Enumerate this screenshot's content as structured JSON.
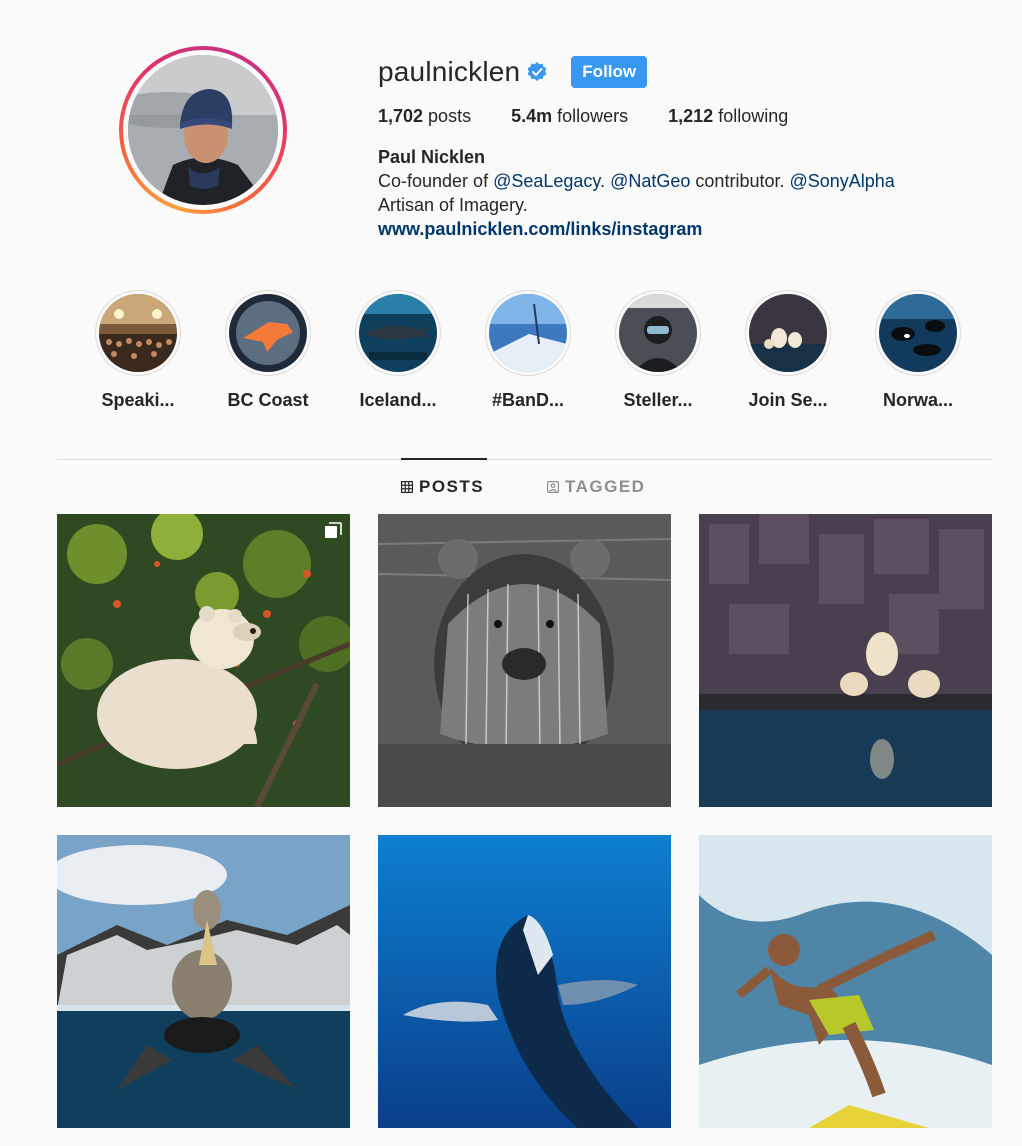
{
  "profile": {
    "username": "paulnicklen",
    "verified": true,
    "follow_label": "Follow",
    "stats": {
      "posts_count": "1,702",
      "posts_label": " posts",
      "followers_count": "5.4m",
      "followers_label": " followers",
      "following_count": "1,212",
      "following_label": " following"
    },
    "full_name": "Paul Nicklen",
    "bio": {
      "prefix": "Co-founder of ",
      "mention1": "@SeaLegacy",
      "sep1": ". ",
      "mention2": "@NatGeo",
      "mid": " contributor. ",
      "mention3": "@SonyAlpha",
      "line2": "Artisan of Imagery."
    },
    "link": "www.paulnicklen.com/links/instagram"
  },
  "highlights": [
    {
      "label": "Speaki..."
    },
    {
      "label": "BC Coast"
    },
    {
      "label": "Iceland..."
    },
    {
      "label": "#BanD..."
    },
    {
      "label": "Steller..."
    },
    {
      "label": "Join Se..."
    },
    {
      "label": "Norwa..."
    }
  ],
  "tabs": {
    "posts": "POSTS",
    "tagged": "TAGGED"
  },
  "colors": {
    "follow_blue": "#3897f0",
    "link_blue": "#00376b",
    "text": "#262626",
    "muted": "#8e8e8e"
  },
  "posts": [
    {
      "subject": "spirit bear in berry bush",
      "multiple": true
    },
    {
      "subject": "grizzly bear black and white"
    },
    {
      "subject": "polar bears on rocks"
    },
    {
      "subject": "albatross split-level"
    },
    {
      "subject": "whale underwater"
    },
    {
      "subject": "surfer in wave"
    }
  ]
}
